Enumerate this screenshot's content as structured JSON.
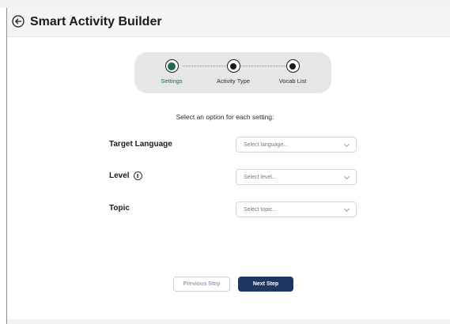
{
  "header": {
    "title": "Smart Activity Builder",
    "back_icon": "arrow-left-circle-icon"
  },
  "stepper": {
    "steps": [
      {
        "label": "Settings",
        "active": true
      },
      {
        "label": "Activity Type",
        "active": false
      },
      {
        "label": "Vocab List",
        "active": false
      }
    ],
    "active_color": "#1e6b4e"
  },
  "form": {
    "instruction": "Select an option for each setting:",
    "fields": [
      {
        "label": "Target Language",
        "placeholder": "Select language...",
        "has_info": false
      },
      {
        "label": "Level",
        "placeholder": "Select level...",
        "has_info": true
      },
      {
        "label": "Topic",
        "placeholder": "Select topic...",
        "has_info": false
      }
    ]
  },
  "actions": {
    "previous_label": "Previous Step",
    "next_label": "Next Step",
    "next_color": "#1f3660"
  }
}
